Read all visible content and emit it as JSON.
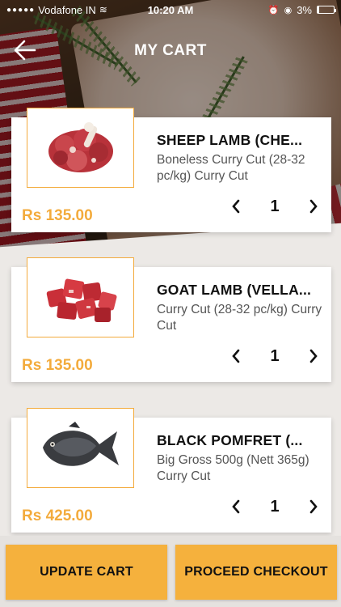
{
  "status_bar": {
    "carrier": "Vodafone IN",
    "time": "10:20 AM",
    "battery": "3%"
  },
  "header": {
    "title": "MY CART",
    "back_icon": "arrow-left-icon"
  },
  "colors": {
    "accent": "#f3ab3c",
    "button": "#f5b13d"
  },
  "cart": {
    "items": [
      {
        "name": "SHEEP LAMB (CHE...",
        "description": " Boneless Curry Cut (28-32 pc/kg) Curry Cut",
        "price": "Rs 135.00",
        "quantity": "1",
        "image_icon": "lamb-meat-icon"
      },
      {
        "name": "GOAT LAMB (VELLA...",
        "description": " Curry Cut (28-32 pc/kg) Curry Cut",
        "price": "Rs 135.00",
        "quantity": "1",
        "image_icon": "goat-meat-icon"
      },
      {
        "name": "BLACK POMFRET (...",
        "description": " Big Gross 500g (Nett 365g) Curry Cut",
        "price": "Rs 425.00",
        "quantity": "1",
        "image_icon": "fish-icon"
      }
    ]
  },
  "actions": {
    "update_label": "UPDATE CART",
    "checkout_label": "PROCEED CHECKOUT"
  }
}
